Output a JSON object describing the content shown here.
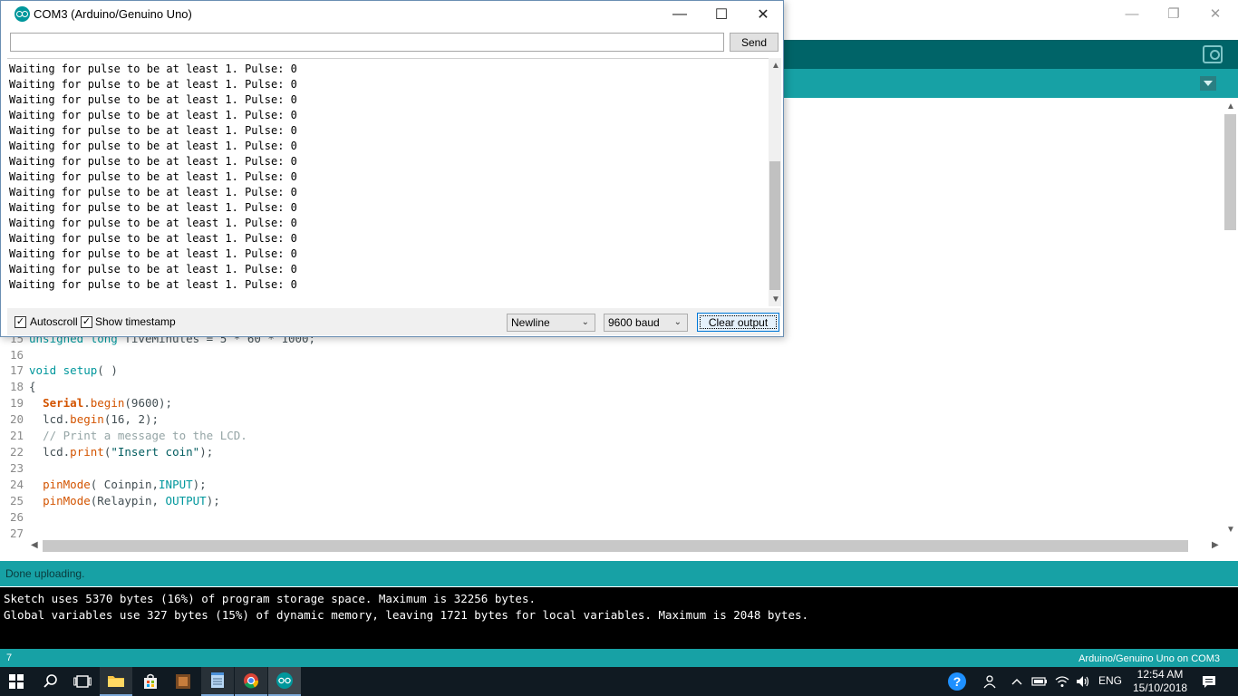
{
  "ide": {
    "status": "Done uploading.",
    "console_lines": [
      "Sketch uses 5370 bytes (16%) of program storage space. Maximum is 32256 bytes.",
      "Global variables use 327 bytes (15%) of dynamic memory, leaving 1721 bytes for local variables. Maximum is 2048 bytes."
    ],
    "footer_line": "7",
    "board": "Arduino/Genuino Uno on COM3",
    "code": {
      "l15_num": "15",
      "l15_a": "unsigned long",
      "l15_b": " fiveMinutes = 5 * 60 * 1000;",
      "l16_num": "16",
      "l17_num": "17",
      "l17_a": "void",
      "l17_b": " ",
      "l17_c": "setup",
      "l17_d": "( )",
      "l18_num": "18",
      "l18_a": "{",
      "l19_num": "19",
      "l19_a": "Serial",
      "l19_b": ".",
      "l19_c": "begin",
      "l19_d": "(9600);",
      "l20_num": "20",
      "l20_a": "lcd.",
      "l20_b": "begin",
      "l20_c": "(16, 2);",
      "l21_num": "21",
      "l21_a": "// Print a message to the LCD.",
      "l22_num": "22",
      "l22_a": "lcd.",
      "l22_b": "print",
      "l22_c": "(",
      "l22_d": "\"Insert coin\"",
      "l22_e": ");",
      "l23_num": "23",
      "l24_num": "24",
      "l24_a": "pinMode",
      "l24_b": "( Coinpin,",
      "l24_c": "INPUT",
      "l24_d": ");",
      "l25_num": "25",
      "l25_a": "pinMode",
      "l25_b": "(Relaypin, ",
      "l25_c": "OUTPUT",
      "l25_d": ");",
      "l26_num": "26",
      "l27_num": "27"
    }
  },
  "serial_monitor": {
    "title": "COM3 (Arduino/Genuino Uno)",
    "input_value": "",
    "send_label": "Send",
    "output_lines": [
      "Waiting for pulse to be at least 1. Pulse: 0",
      "Waiting for pulse to be at least 1. Pulse: 0",
      "Waiting for pulse to be at least 1. Pulse: 0",
      "Waiting for pulse to be at least 1. Pulse: 0",
      "Waiting for pulse to be at least 1. Pulse: 0",
      "Waiting for pulse to be at least 1. Pulse: 0",
      "Waiting for pulse to be at least 1. Pulse: 0",
      "Waiting for pulse to be at least 1. Pulse: 0",
      "Waiting for pulse to be at least 1. Pulse: 0",
      "Waiting for pulse to be at least 1. Pulse: 0",
      "Waiting for pulse to be at least 1. Pulse: 0",
      "Waiting for pulse to be at least 1. Pulse: 0",
      "Waiting for pulse to be at least 1. Pulse: 0",
      "Waiting for pulse to be at least 1. Pulse: 0",
      "Waiting for pulse to be at least 1. Pulse: 0"
    ],
    "autoscroll_label": "Autoscroll",
    "autoscroll_checked": true,
    "timestamp_label": "Show timestamp",
    "timestamp_checked": true,
    "line_ending": "Newline",
    "baud": "9600 baud",
    "clear_label": "Clear output"
  },
  "taskbar": {
    "language": "ENG",
    "time": "12:54 AM",
    "date": "15/10/2018",
    "help_glyph": "?"
  },
  "colors": {
    "ide_teal": "#17a1a5",
    "ide_dark_teal": "#006468",
    "taskbar": "#101a22"
  }
}
